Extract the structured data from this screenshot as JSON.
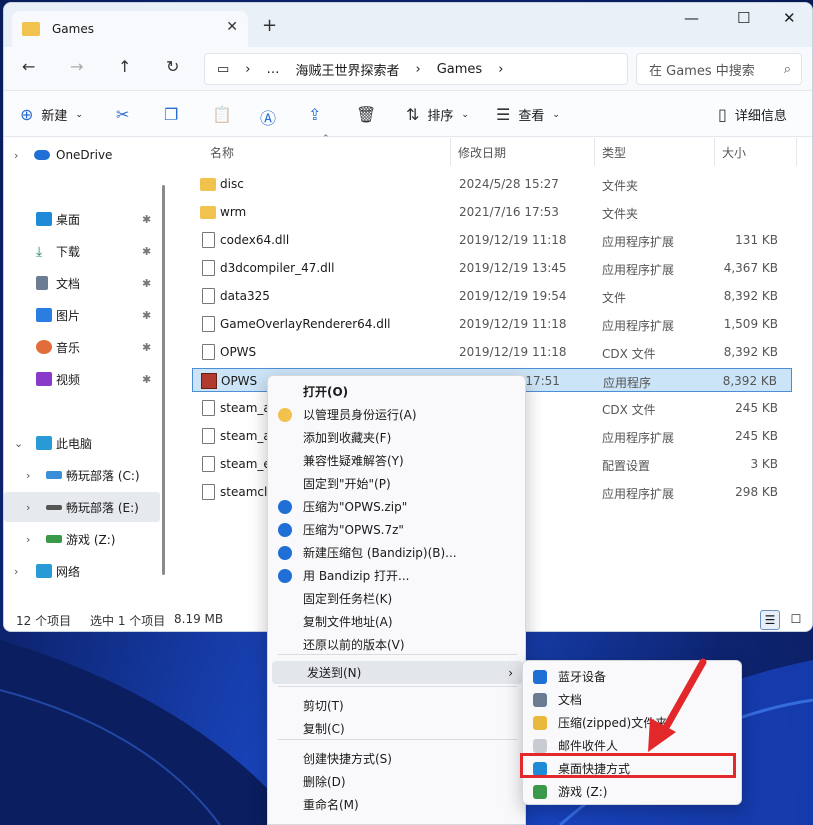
{
  "window": {
    "tab_title": "Games",
    "new_tab": "+"
  },
  "nav": {
    "path": [
      "…",
      "海贼王世界探索者",
      "Games"
    ],
    "search_placeholder": "在 Games 中搜索"
  },
  "toolbar": {
    "new_label": "新建",
    "sort_label": "排序",
    "view_label": "查看",
    "details_label": "详细信息"
  },
  "sidebar": {
    "items": [
      {
        "label": "OneDrive"
      },
      {
        "label": "桌面"
      },
      {
        "label": "下载"
      },
      {
        "label": "文档"
      },
      {
        "label": "图片"
      },
      {
        "label": "音乐"
      },
      {
        "label": "视频"
      },
      {
        "label": "此电脑"
      },
      {
        "label": "畅玩部落 (C:)"
      },
      {
        "label": "畅玩部落 (E:)"
      },
      {
        "label": "游戏 (Z:)"
      },
      {
        "label": "网络"
      }
    ]
  },
  "columns": {
    "name": "名称",
    "date": "修改日期",
    "type": "类型",
    "size": "大小"
  },
  "files": [
    {
      "name": "disc",
      "date": "2024/5/28 15:27",
      "type": "文件夹",
      "size": ""
    },
    {
      "name": "wrm",
      "date": "2021/7/16 17:53",
      "type": "文件夹",
      "size": ""
    },
    {
      "name": "codex64.dll",
      "date": "2019/12/19 11:18",
      "type": "应用程序扩展",
      "size": "131 KB"
    },
    {
      "name": "d3dcompiler_47.dll",
      "date": "2019/12/19 13:45",
      "type": "应用程序扩展",
      "size": "4,367 KB"
    },
    {
      "name": "data325",
      "date": "2019/12/19 19:54",
      "type": "文件",
      "size": "8,392 KB"
    },
    {
      "name": "GameOverlayRenderer64.dll",
      "date": "2019/12/19 11:18",
      "type": "应用程序扩展",
      "size": "1,509 KB"
    },
    {
      "name": "OPWS",
      "date": "2019/12/19 11:18",
      "type": "CDX 文件",
      "size": "8,392 KB"
    },
    {
      "name": "OPWS",
      "date": "2024/5/16 17:51",
      "type": "应用程序",
      "size": "8,392 KB"
    },
    {
      "name": "steam_ap",
      "date": "11:18",
      "type": "CDX 文件",
      "size": "245 KB"
    },
    {
      "name": "steam_ap",
      "date": "11:18",
      "type": "应用程序扩展",
      "size": "245 KB"
    },
    {
      "name": "steam_er",
      "date": "7:53",
      "type": "配置设置",
      "size": "3 KB"
    },
    {
      "name": "steamclie",
      "date": "11:18",
      "type": "应用程序扩展",
      "size": "298 KB"
    }
  ],
  "status": {
    "count": "12 个项目",
    "selected": "选中 1 个项目",
    "size": "8.19 MB"
  },
  "context_menu": [
    "打开(O)",
    "以管理员身份运行(A)",
    "添加到收藏夹(F)",
    "兼容性疑难解答(Y)",
    "固定到\"开始\"(P)",
    "压缩为\"OPWS.zip\"",
    "压缩为\"OPWS.7z\"",
    "新建压缩包 (Bandizip)(B)...",
    "用 Bandizip 打开...",
    "固定到任务栏(K)",
    "复制文件地址(A)",
    "还原以前的版本(V)",
    "发送到(N)",
    "剪切(T)",
    "复制(C)",
    "创建快捷方式(S)",
    "删除(D)",
    "重命名(M)"
  ],
  "sendto_menu": [
    "蓝牙设备",
    "文档",
    "压缩(zipped)文件夹",
    "邮件收件人",
    "桌面快捷方式",
    "游戏 (Z:)"
  ],
  "colors": {
    "highlight": "#e3282b",
    "selection": "#cce4f7",
    "accent": "#2a6ccf"
  }
}
